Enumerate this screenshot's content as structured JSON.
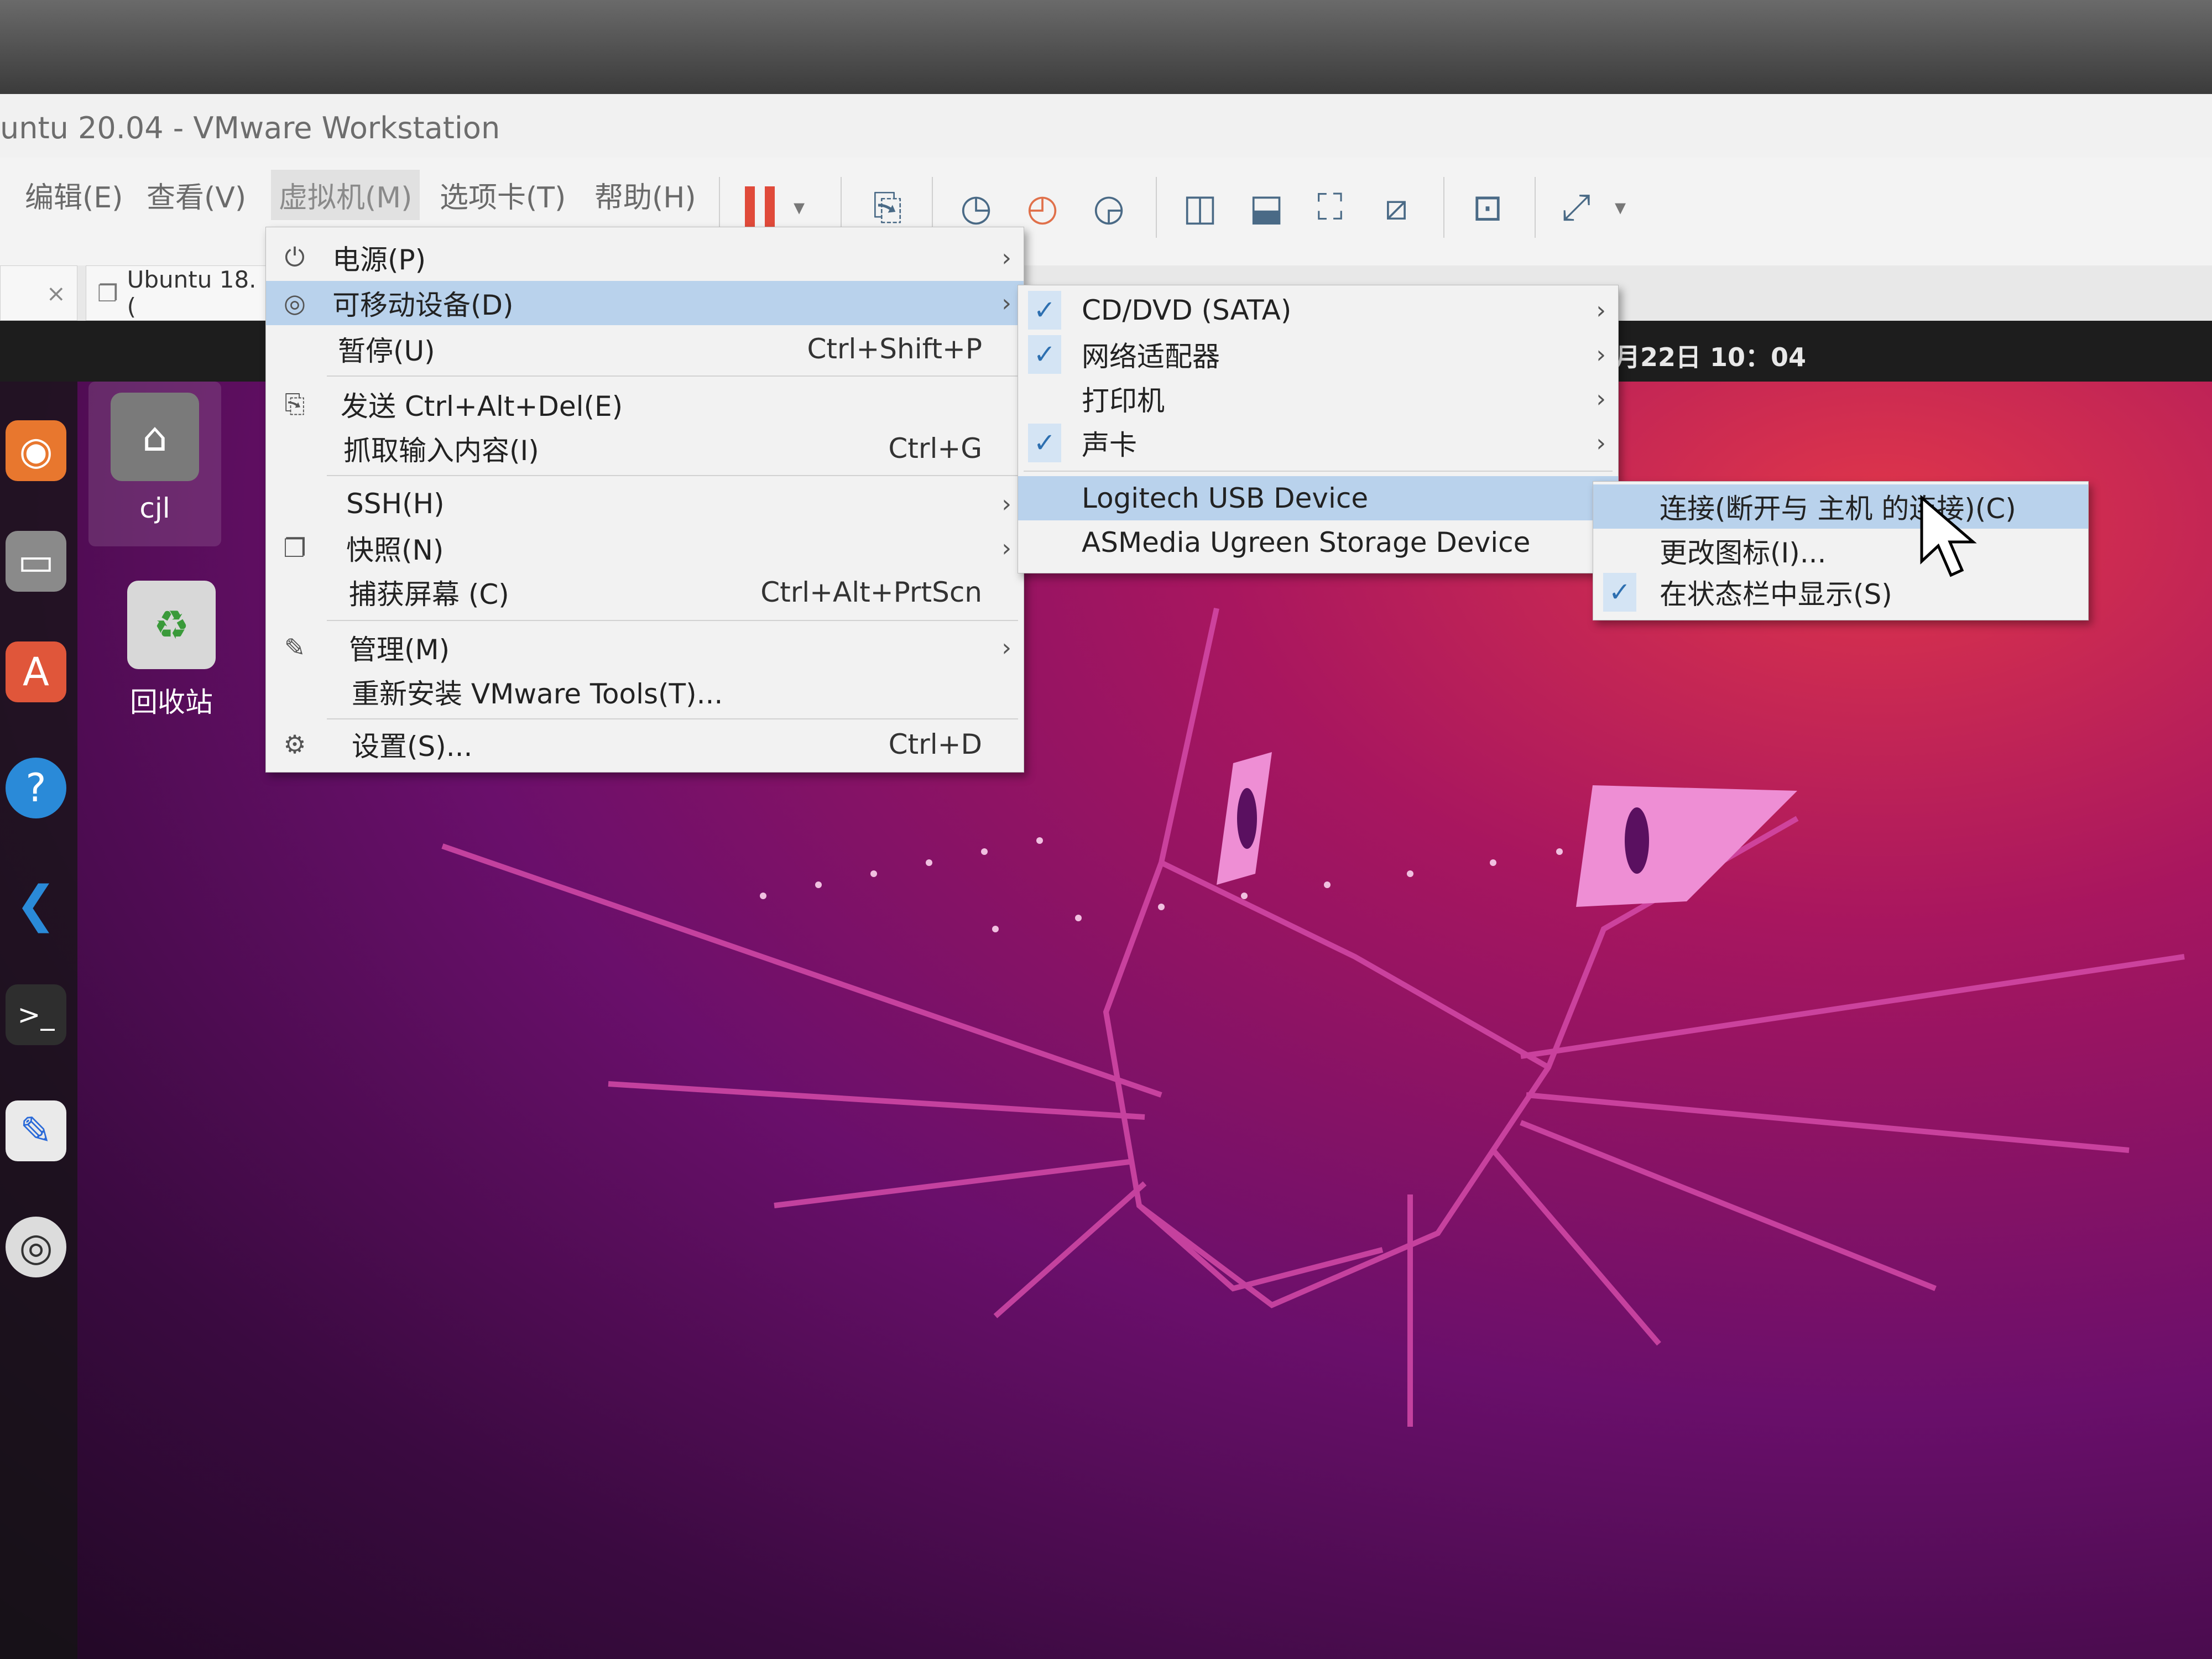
{
  "window": {
    "title": "untu 20.04 - VMware Workstation"
  },
  "menubar": {
    "items": [
      "编辑(E)",
      "查看(V)",
      "虚拟机(M)",
      "选项卡(T)",
      "帮助(H)"
    ]
  },
  "toolbar": {
    "icons": [
      "pause-icon",
      "dropdown-icon",
      "send-ctrl-alt-del-icon",
      "snapshot-icon",
      "revert-snapshot-icon",
      "manage-snapshots-icon",
      "view-full-icon",
      "view-console-icon",
      "fit-guest-icon",
      "unity-icon",
      "terminal-icon",
      "fullscreen-icon"
    ]
  },
  "tabs": {
    "prev_tab_close": "×",
    "current": "Ubuntu 18.("
  },
  "guest": {
    "clock": "月22日  10：04",
    "desktop_icons": [
      {
        "label": "cjl",
        "icon": "home-folder-icon"
      },
      {
        "label": "回收站",
        "icon": "trash-icon"
      }
    ],
    "dock_icons": [
      "firefox-icon",
      "files-icon",
      "software-icon",
      "help-icon",
      "vscode-icon",
      "terminal-icon",
      "text-editor-icon",
      "dvd-icon"
    ]
  },
  "vm_menu": {
    "items": [
      {
        "label": "电源(P)",
        "shortcut": "",
        "submenu": true,
        "icon": "power-icon"
      },
      {
        "label": "可移动设备(D)",
        "shortcut": "",
        "submenu": true,
        "icon": "removable-devices-icon"
      },
      {
        "label": "暂停(U)",
        "shortcut": "Ctrl+Shift+P",
        "submenu": false,
        "icon": ""
      },
      {
        "label": "发送 Ctrl+Alt+Del(E)",
        "shortcut": "",
        "submenu": false,
        "icon": "send-keys-icon"
      },
      {
        "label": "抓取输入内容(I)",
        "shortcut": "Ctrl+G",
        "submenu": false,
        "icon": ""
      },
      {
        "label": "SSH(H)",
        "shortcut": "",
        "submenu": true,
        "icon": ""
      },
      {
        "label": "快照(N)",
        "shortcut": "",
        "submenu": true,
        "icon": "snapshot-icon"
      },
      {
        "label": "捕获屏幕 (C)",
        "shortcut": "Ctrl+Alt+PrtScn",
        "submenu": false,
        "icon": ""
      },
      {
        "label": "管理(M)",
        "shortcut": "",
        "submenu": true,
        "icon": "wrench-icon"
      },
      {
        "label": "重新安装 VMware Tools(T)...",
        "shortcut": "",
        "submenu": false,
        "icon": ""
      },
      {
        "label": "设置(S)...",
        "shortcut": "Ctrl+D",
        "submenu": false,
        "icon": "settings-icon"
      }
    ]
  },
  "devices_menu": {
    "items": [
      {
        "label": "CD/DVD (SATA)",
        "checked": true
      },
      {
        "label": "网络适配器",
        "checked": true
      },
      {
        "label": "打印机",
        "checked": false
      },
      {
        "label": "声卡",
        "checked": true
      },
      {
        "label": "Logitech USB Device",
        "checked": false
      },
      {
        "label": "ASMedia Ugreen Storage Device",
        "checked": false
      }
    ]
  },
  "usb_menu": {
    "items": [
      {
        "label": "连接(断开与 主机 的连接)(C)",
        "checked": false
      },
      {
        "label": "更改图标(I)...",
        "checked": false
      },
      {
        "label": "在状态栏中显示(S)",
        "checked": true
      }
    ]
  },
  "colors": {
    "menu_highlight": "#b9d2ec",
    "check_blue": "#2d6fb0",
    "pause_red": "#e04a3a",
    "wallpaper_magenta": "#a8165f"
  }
}
